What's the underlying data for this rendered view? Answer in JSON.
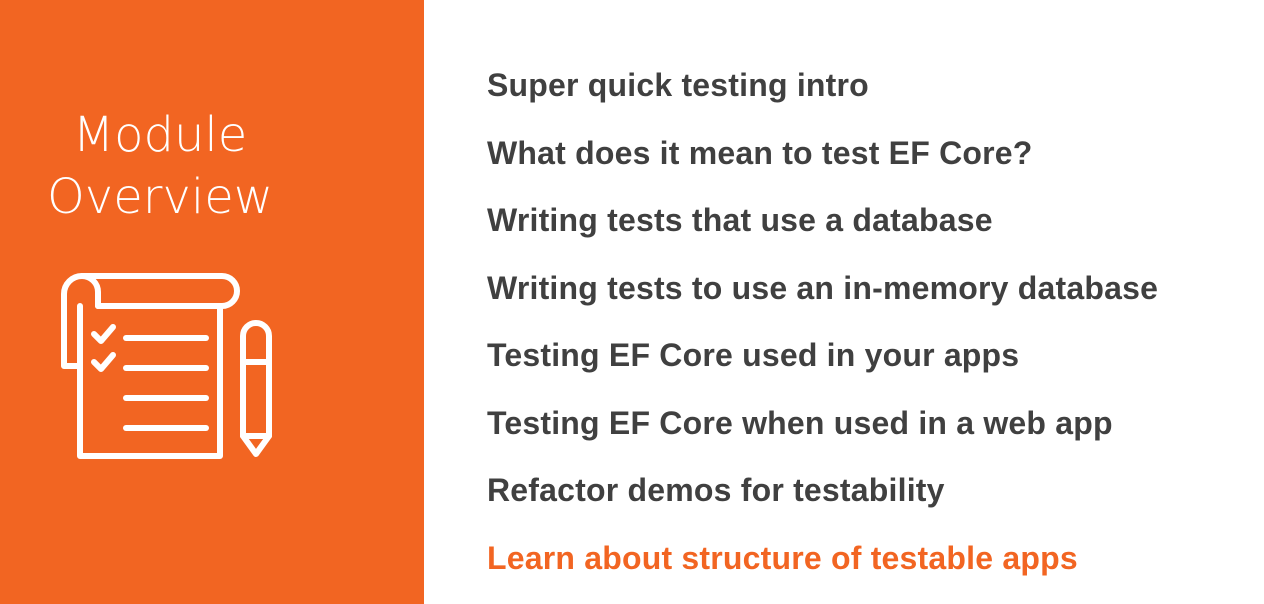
{
  "slide": {
    "title_line1": "Module",
    "title_line2": "Overview",
    "icon": "checklist-notepad-and-pen-icon",
    "colors": {
      "accent": "#f26522",
      "text": "#404040",
      "background": "#ffffff"
    },
    "topics": [
      {
        "label": "Super quick testing intro",
        "current": false
      },
      {
        "label": "What does it mean to test EF Core?",
        "current": false
      },
      {
        "label": "Writing tests that use a database",
        "current": false
      },
      {
        "label": "Writing tests to use an in-memory database",
        "current": false
      },
      {
        "label": "Testing EF Core used in your apps",
        "current": false
      },
      {
        "label": "Testing EF Core when used in a web app",
        "current": false
      },
      {
        "label": "Refactor demos for testability",
        "current": false
      },
      {
        "label": "Learn about structure of testable apps",
        "current": true
      }
    ]
  }
}
